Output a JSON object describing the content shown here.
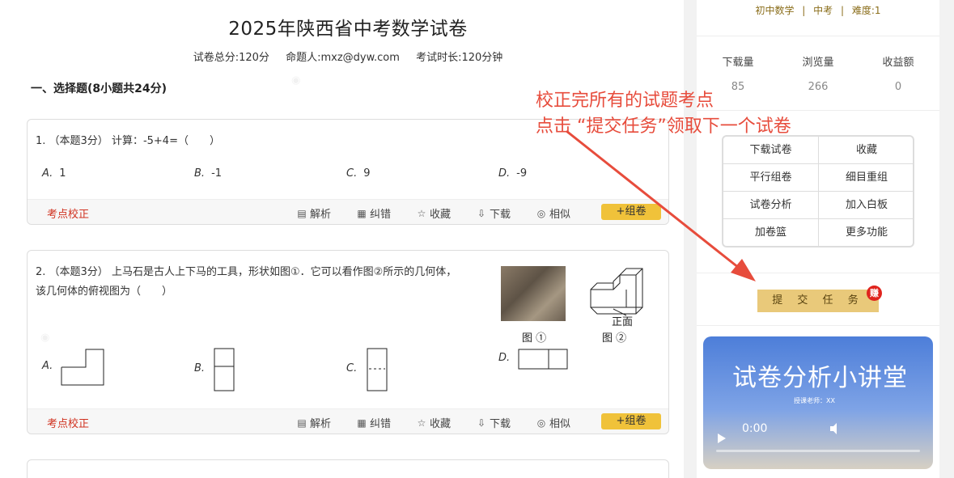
{
  "paper": {
    "title": "2025年陕西省中考数学试卷",
    "total_score": "试卷总分:120分",
    "author": "命题人:mxz@dyw.com",
    "duration": "考试时长:120分钟",
    "section_title": "一、选择题(8小题共24分)"
  },
  "q1": {
    "text": "1. （本题3分） 计算：-5+4=（　　）",
    "options": [
      {
        "letter": "A.",
        "value": "1"
      },
      {
        "letter": "B.",
        "value": "-1"
      },
      {
        "letter": "C.",
        "value": "9"
      },
      {
        "letter": "D.",
        "value": "-9"
      }
    ]
  },
  "q2": {
    "text_line1": "2. （本题3分） 上马石是古人上下马的工具，形状如图①．它可以看作图②所示的几何体，",
    "text_line2": "该几何体的俯视图为（　　）",
    "fig1_caption": "图 ①",
    "fig2_caption": "图 ②",
    "front_label": "正面",
    "options": [
      "A.",
      "B.",
      "C.",
      "D."
    ]
  },
  "footer": {
    "correct": "考点校正",
    "parse": "解析",
    "report": "纠错",
    "collect": "收藏",
    "download": "下载",
    "similar": "相似",
    "add": "+组卷"
  },
  "sidebar": {
    "tags": [
      "初中数学",
      "|",
      "中考",
      "|",
      "难度:1"
    ],
    "stats": [
      {
        "label": "下载量",
        "value": "85"
      },
      {
        "label": "浏览量",
        "value": "266"
      },
      {
        "label": "收益额",
        "value": "0"
      }
    ],
    "buttons": [
      "下载试卷",
      "收藏",
      "平行组卷",
      "细目重组",
      "试卷分析",
      "加入白板",
      "加卷篮",
      "更多功能"
    ],
    "submit_label": "提 交 任 务",
    "submit_badge": "赚",
    "video": {
      "title": "试卷分析小讲堂",
      "subtitle": "授课老师：XX",
      "time": "0:00"
    }
  },
  "annotation": {
    "line1": "校正完所有的试题考点",
    "line2": "点击 “提交任务”领取下一个试卷"
  },
  "colors": {
    "accent_red": "#d0311f",
    "zujuan_yellow": "#f0c23a",
    "submit_gold": "#e9c97a",
    "annotation_red": "#e74c3c"
  }
}
